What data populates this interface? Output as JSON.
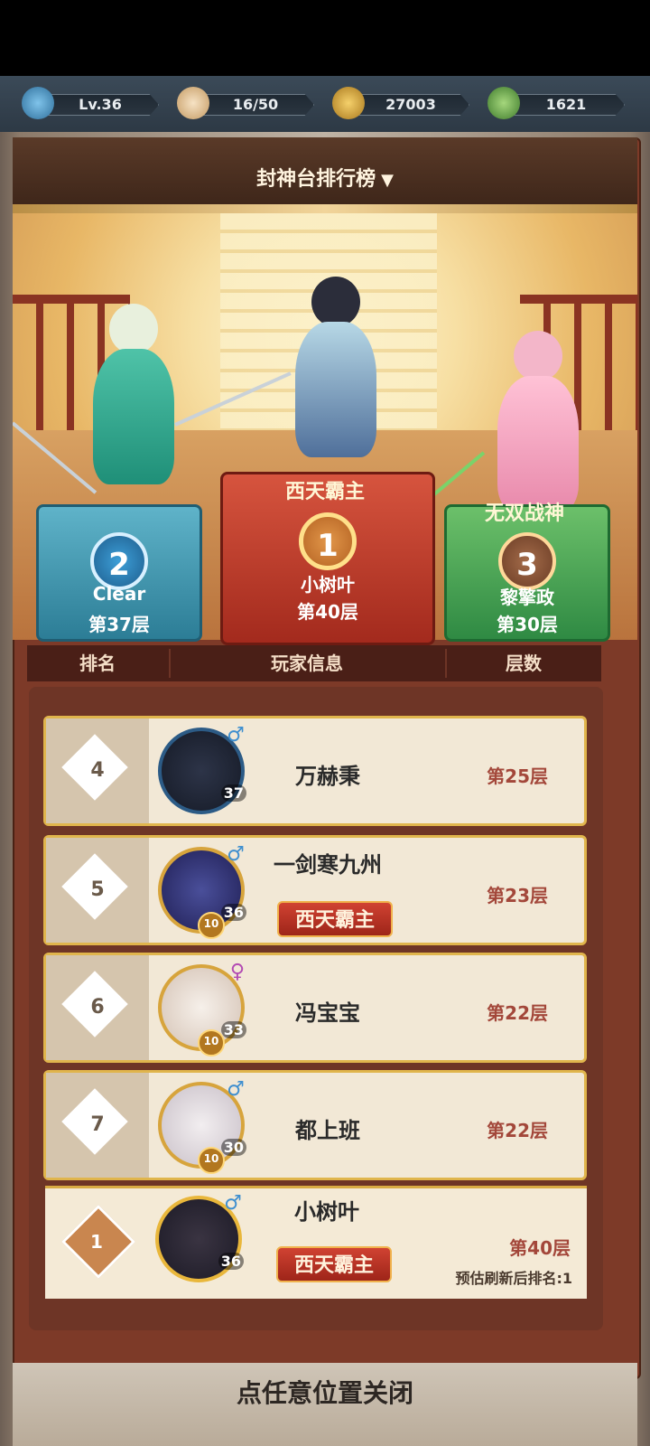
{
  "resources": {
    "level": "Lv.36",
    "stamina": "16/50",
    "coins": "27003",
    "jade": "1621"
  },
  "header": {
    "title": "封神台排行榜",
    "dropdown_icon": "▼"
  },
  "podium": {
    "first": {
      "rank": "1",
      "title": "西天霸主",
      "name": "小树叶",
      "floor": "第40层"
    },
    "second": {
      "rank": "2",
      "name": "Clear",
      "floor": "第37层"
    },
    "third": {
      "rank": "3",
      "title": "无双战神",
      "name": "黎擎政",
      "floor": "第30层"
    }
  },
  "columns": {
    "rank": "排名",
    "player": "玩家信息",
    "floor": "层数"
  },
  "rows": [
    {
      "rank": "4",
      "name": "万赫秉",
      "level": "37",
      "gender": "♂",
      "floor": "第25层"
    },
    {
      "rank": "5",
      "name": "一剑寒九州",
      "level": "36",
      "gender": "♂",
      "floor": "第23层",
      "title": "西天霸主",
      "badge": "10"
    },
    {
      "rank": "6",
      "name": "冯宝宝",
      "level": "33",
      "gender": "♀",
      "floor": "第22层",
      "badge": "10"
    },
    {
      "rank": "7",
      "name": "都上班",
      "level": "30",
      "gender": "♂",
      "floor": "第22层",
      "badge": "10"
    }
  ],
  "me": {
    "rank": "1",
    "name": "小树叶",
    "level": "36",
    "gender": "♂",
    "title": "西天霸主",
    "floor": "第40层",
    "estimate": "预估刷新后排名:1"
  },
  "footer": {
    "close_hint": "点任意位置关闭"
  }
}
